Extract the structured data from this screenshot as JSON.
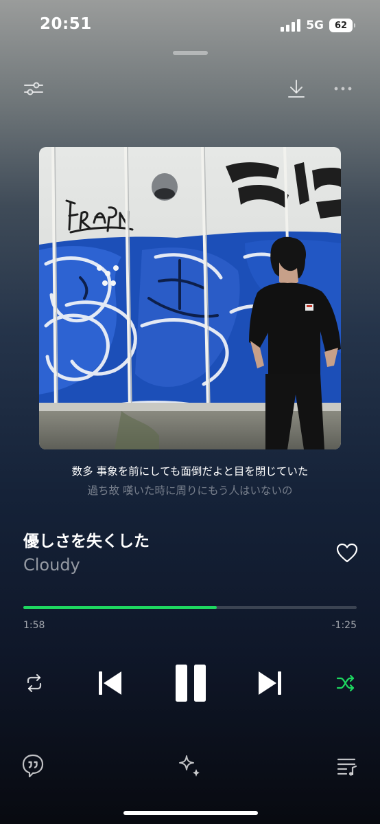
{
  "status_bar": {
    "time": "20:51",
    "network": "5G",
    "battery": "62"
  },
  "toolbar_top": {
    "icons": [
      "equalizer-sliders-icon",
      "download-icon",
      "more-options-icon"
    ]
  },
  "lyrics": {
    "current_line": "数多 事象を前にしても面倒だよと目を閉じていた",
    "next_line": "過ち故 嘆いた時に周りにもう人はいないの"
  },
  "track": {
    "title": "優しさを失くした",
    "artist": "Cloudy",
    "liked": false
  },
  "playback": {
    "elapsed": "1:58",
    "remaining": "-1:25",
    "progress_fraction": 0.58,
    "state": "playing",
    "shuffle_on": true,
    "repeat_on": false
  },
  "toolbar_bottom": {
    "icons": [
      "lyrics-quote-icon",
      "sparkle-icon",
      "queue-icon"
    ]
  },
  "colors": {
    "accent": "#1ed760",
    "text_primary": "#ffffff",
    "text_secondary": "#9aa0a8"
  }
}
